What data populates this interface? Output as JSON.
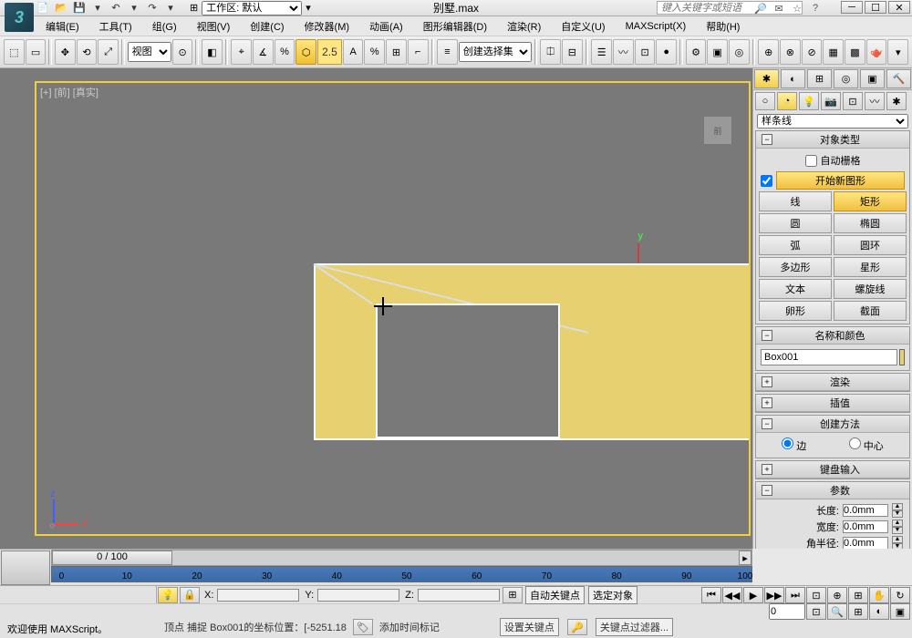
{
  "title": "别墅.max",
  "search_placeholder": "键入关键字或短语",
  "workspace": {
    "label": "工作区: 默认",
    "options": [
      "工作区: 默认"
    ]
  },
  "menu": [
    "编辑(E)",
    "工具(T)",
    "组(G)",
    "视图(V)",
    "创建(C)",
    "修改器(M)",
    "动画(A)",
    "图形编辑器(D)",
    "渲染(R)",
    "自定义(U)",
    "MAXScript(X)",
    "帮助(H)"
  ],
  "toolbar": {
    "ref_coord": "视图",
    "angle_snap": "2.5",
    "selection_set": "创建选择集"
  },
  "viewport": {
    "label": "[+] [前] [真实]",
    "cube_face": "前"
  },
  "cmdpanel": {
    "category": "样条线",
    "rollouts": {
      "object_type": {
        "title": "对象类型",
        "autogrid": "自动栅格",
        "start_new": "开始新图形",
        "buttons": [
          [
            "线",
            "矩形"
          ],
          [
            "圆",
            "椭圆"
          ],
          [
            "弧",
            "圆环"
          ],
          [
            "多边形",
            "星形"
          ],
          [
            "文本",
            "螺旋线"
          ],
          [
            "卵形",
            "截面"
          ]
        ],
        "active": "矩形"
      },
      "name_color": {
        "title": "名称和颜色",
        "name": "Box001"
      },
      "render": "渲染",
      "interp": "插值",
      "creation": {
        "title": "创建方法",
        "edge": "边",
        "center": "中心"
      },
      "keyboard": "键盘输入",
      "params": {
        "title": "参数",
        "length": {
          "label": "长度:",
          "value": "0.0mm"
        },
        "width": {
          "label": "宽度:",
          "value": "0.0mm"
        },
        "corner": {
          "label": "角半径:",
          "value": "0.0mm"
        }
      }
    }
  },
  "timeslider": {
    "position": "0 / 100",
    "ticks": [
      0,
      10,
      20,
      30,
      40,
      50,
      60,
      70,
      80,
      90,
      100
    ]
  },
  "status": {
    "welcome": "欢迎使用 MAXScript。",
    "prompt": "",
    "info": "顶点 捕捉 Box001的坐标位置：[-5251.18",
    "add_time_marker": "添加时间标记",
    "autokey": "自动关键点",
    "selected": "选定对象",
    "setkey": "设置关键点",
    "keyfilter": "关键点过滤器..."
  }
}
